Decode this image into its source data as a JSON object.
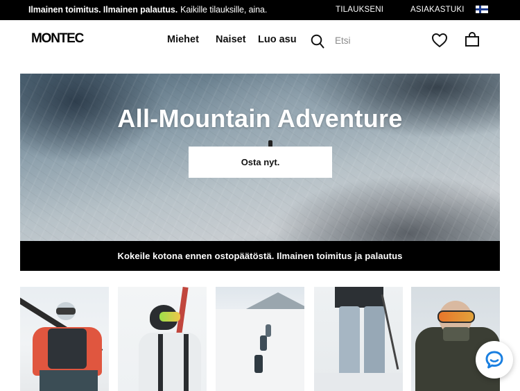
{
  "topbar": {
    "promo_bold": "Ilmainen toimitus. Ilmainen palautus.",
    "promo_regular": "Kaikille tilauksille, aina.",
    "orders_link": "TILAUKSENI",
    "support_link": "ASIAKASTUKI",
    "language_icon": "finland-flag-icon"
  },
  "header": {
    "logo": "MONTEC",
    "nav": {
      "men": "Miehet",
      "women": "Naiset",
      "outfit": "Luo asu"
    },
    "search": {
      "placeholder": "Etsi",
      "icon": "search-icon"
    },
    "wishlist_icon": "heart-icon",
    "cart_icon": "bag-icon"
  },
  "hero": {
    "title": "All-Mountain Adventure",
    "cta": "Osta nyt."
  },
  "infobar": {
    "text": "Kokeile kotona ennen ostopäätöstä. Ilmainen toimitus ja palautus"
  },
  "colors": {
    "topbar_bg": "#000000",
    "accent_chat": "#1a7fe0",
    "jacket_red": "#e0563f",
    "goggle_orange": "#e8762b"
  },
  "chat": {
    "icon": "chat-bubble-icon"
  }
}
